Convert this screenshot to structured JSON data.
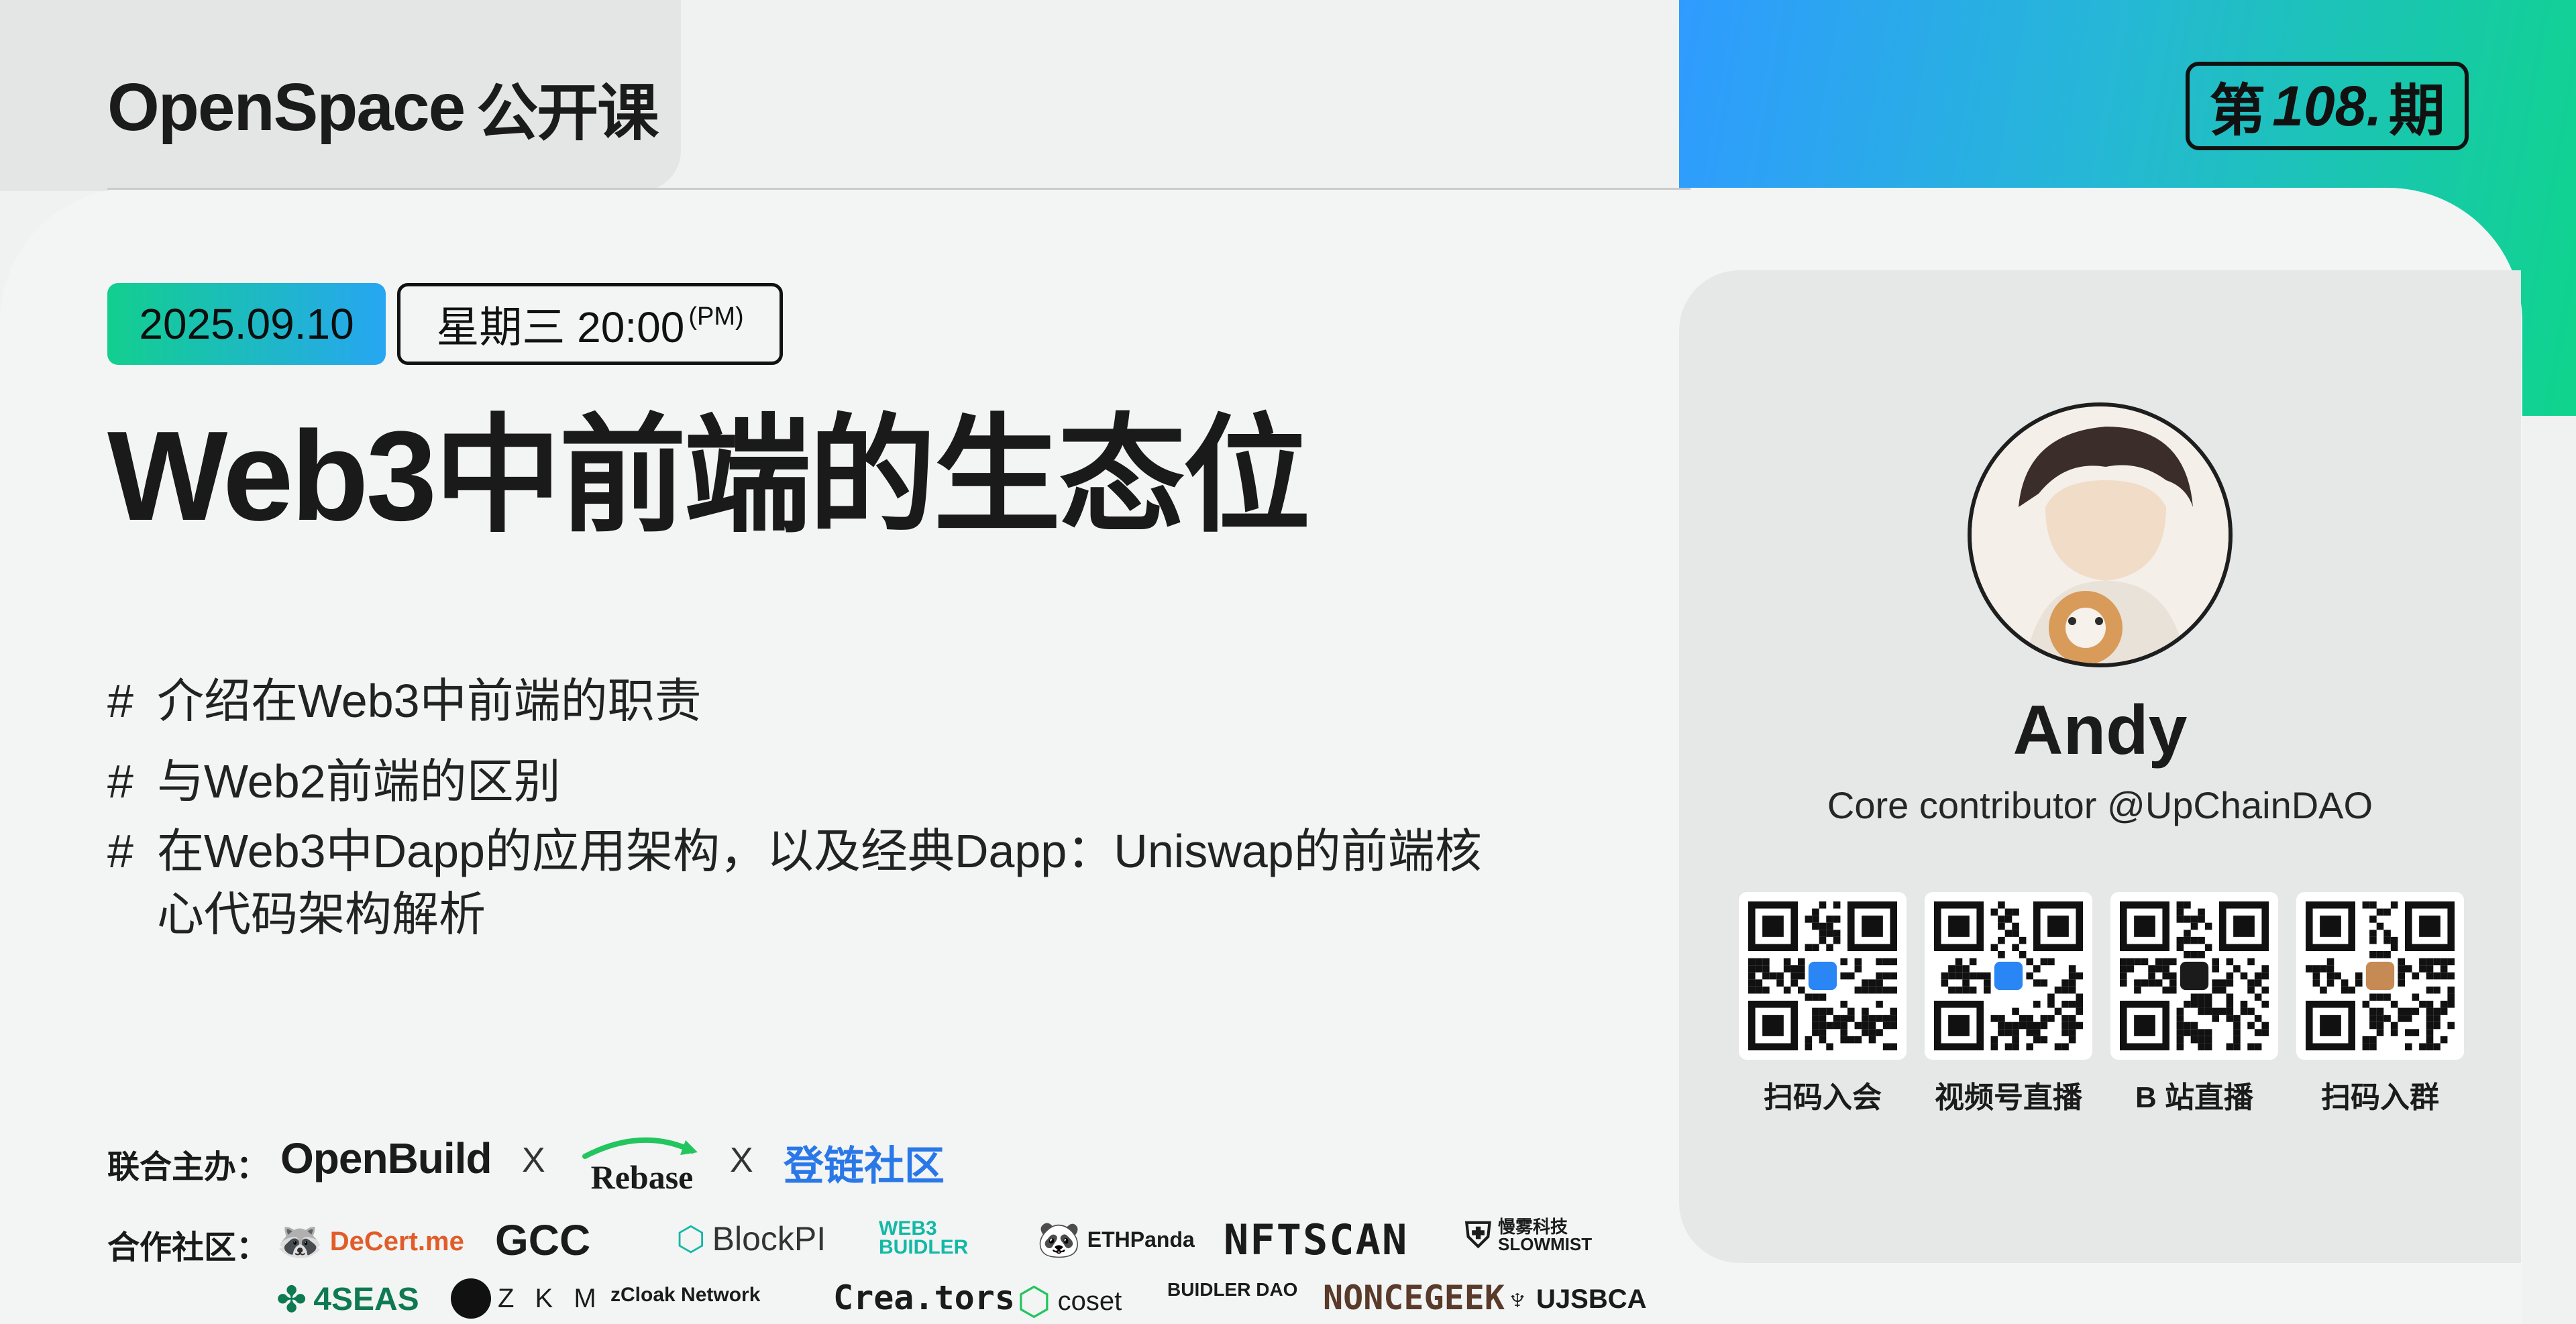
{
  "header": {
    "brand": "OpenSpace",
    "brand_cn": "公开课",
    "issue_prefix": "第",
    "issue_number": "108.",
    "issue_suffix": "期"
  },
  "event": {
    "date": "2025.09.10",
    "time": "星期三 20:00",
    "time_suffix": "(PM)",
    "title": "Web3中前端的生态位"
  },
  "topics": [
    "介绍在Web3中前端的职责",
    "与Web2前端的区别",
    "在Web3中Dapp的应用架构，以及经典Dapp：Uniswap的前端核心代码架构解析"
  ],
  "bullet_mark": "#",
  "organizers": {
    "label": "联合主办：",
    "separator": "X",
    "logos": [
      "OpenBuild",
      "Rebase",
      "登链社区"
    ]
  },
  "partners": {
    "label": "合作社区：",
    "row1": [
      "DeCert.me",
      "GCC",
      "BlockPI",
      "WEB3 BUIDLER",
      "ETHPanda",
      "NFTSCAN",
      "慢雾科技 SLOWMIST"
    ],
    "row2": [
      "4SEAS",
      "Z K M",
      "zCloak Network",
      "Crea.tors",
      "coset",
      "BUIDLER DAO",
      "NONCEGEEK",
      "UJSBCA"
    ]
  },
  "speaker": {
    "name": "Andy",
    "role": "Core contributor @UpChainDAO"
  },
  "qr_codes": [
    {
      "label": "扫码入会",
      "icon": "upchain-logo-icon",
      "accent": "#2a86f5"
    },
    {
      "label": "视频号直播",
      "icon": "bilibili-blue-icon",
      "accent": "#2a86f5"
    },
    {
      "label": "B 站直播",
      "icon": "play-icon",
      "accent": "#1b1b1b"
    },
    {
      "label": "扫码入群",
      "icon": "avatar-icon",
      "accent": "#c68a55"
    }
  ],
  "colors": {
    "gradient_start": "#2f9bff",
    "gradient_end": "#0fd48c",
    "date_pill_start": "#12cf8e",
    "date_pill_end": "#27a6f2",
    "ink": "#1b1b1b"
  }
}
